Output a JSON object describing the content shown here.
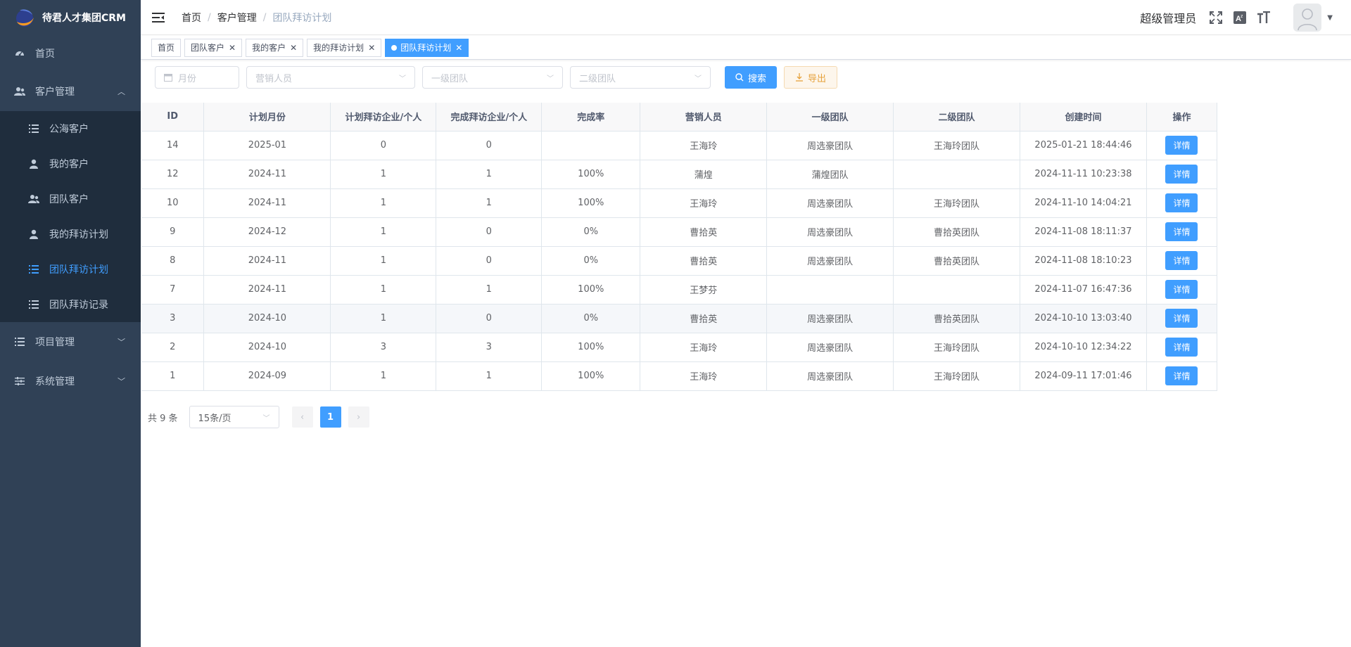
{
  "app": {
    "title": "待君人才集团CRM"
  },
  "sidebar": {
    "items": [
      {
        "label": "首页",
        "icon": "dashboard-icon"
      },
      {
        "label": "客户管理",
        "icon": "peoples-icon",
        "expanded": true,
        "children": [
          {
            "label": "公海客户",
            "icon": "list-icon"
          },
          {
            "label": "我的客户",
            "icon": "user-icon"
          },
          {
            "label": "团队客户",
            "icon": "peoples-icon"
          },
          {
            "label": "我的拜访计划",
            "icon": "user-icon"
          },
          {
            "label": "团队拜访计划",
            "icon": "list-icon",
            "active": true
          },
          {
            "label": "团队拜访记录",
            "icon": "list-icon"
          }
        ]
      },
      {
        "label": "项目管理",
        "icon": "list-icon"
      },
      {
        "label": "系统管理",
        "icon": "settings-icon"
      }
    ]
  },
  "header": {
    "breadcrumb": [
      "首页",
      "客户管理",
      "团队拜访计划"
    ],
    "separator": "/",
    "admin_name": "超级管理员"
  },
  "tags": [
    {
      "label": "首页",
      "closable": false
    },
    {
      "label": "团队客户",
      "closable": true
    },
    {
      "label": "我的客户",
      "closable": true
    },
    {
      "label": "我的拜访计划",
      "closable": true
    },
    {
      "label": "团队拜访计划",
      "closable": true,
      "active": true
    }
  ],
  "filters": {
    "month_placeholder": "月份",
    "sales_placeholder": "营销人员",
    "team1_placeholder": "一级团队",
    "team2_placeholder": "二级团队",
    "search_label": "搜索",
    "export_label": "导出"
  },
  "table": {
    "headers": [
      "ID",
      "计划月份",
      "计划拜访企业/个人",
      "完成拜访企业/个人",
      "完成率",
      "营销人员",
      "一级团队",
      "二级团队",
      "创建时间",
      "操作"
    ],
    "action_label": "详情",
    "rows": [
      {
        "id": "14",
        "month": "2025-01",
        "planned": "0",
        "completed": "0",
        "rate": "",
        "sales": "王海玲",
        "team1": "周选豪团队",
        "team2": "王海玲团队",
        "created": "2025-01-21 18:44:46"
      },
      {
        "id": "12",
        "month": "2024-11",
        "planned": "1",
        "completed": "1",
        "rate": "100%",
        "sales": "蒲煌",
        "team1": "蒲煌团队",
        "team2": "",
        "created": "2024-11-11 10:23:38"
      },
      {
        "id": "10",
        "month": "2024-11",
        "planned": "1",
        "completed": "1",
        "rate": "100%",
        "sales": "王海玲",
        "team1": "周选豪团队",
        "team2": "王海玲团队",
        "created": "2024-11-10 14:04:21"
      },
      {
        "id": "9",
        "month": "2024-12",
        "planned": "1",
        "completed": "0",
        "rate": "0%",
        "sales": "曹拾英",
        "team1": "周选豪团队",
        "team2": "曹拾英团队",
        "created": "2024-11-08 18:11:37"
      },
      {
        "id": "8",
        "month": "2024-11",
        "planned": "1",
        "completed": "0",
        "rate": "0%",
        "sales": "曹拾英",
        "team1": "周选豪团队",
        "team2": "曹拾英团队",
        "created": "2024-11-08 18:10:23"
      },
      {
        "id": "7",
        "month": "2024-11",
        "planned": "1",
        "completed": "1",
        "rate": "100%",
        "sales": "王梦芬",
        "team1": "",
        "team2": "",
        "created": "2024-11-07 16:47:36"
      },
      {
        "id": "3",
        "month": "2024-10",
        "planned": "1",
        "completed": "0",
        "rate": "0%",
        "sales": "曹拾英",
        "team1": "周选豪团队",
        "team2": "曹拾英团队",
        "created": "2024-10-10 13:03:40",
        "hover": true
      },
      {
        "id": "2",
        "month": "2024-10",
        "planned": "3",
        "completed": "3",
        "rate": "100%",
        "sales": "王海玲",
        "team1": "周选豪团队",
        "team2": "王海玲团队",
        "created": "2024-10-10 12:34:22"
      },
      {
        "id": "1",
        "month": "2024-09",
        "planned": "1",
        "completed": "1",
        "rate": "100%",
        "sales": "王海玲",
        "team1": "周选豪团队",
        "team2": "王海玲团队",
        "created": "2024-09-11 17:01:46"
      }
    ]
  },
  "pagination": {
    "total_text": "共 9 条",
    "page_size": "15条/页",
    "current_page": "1"
  },
  "colors": {
    "sidebar_bg": "#304156",
    "submenu_bg": "#1f2d3d",
    "primary": "#409eff",
    "success": "#13ce66",
    "danger": "#ff4949"
  }
}
